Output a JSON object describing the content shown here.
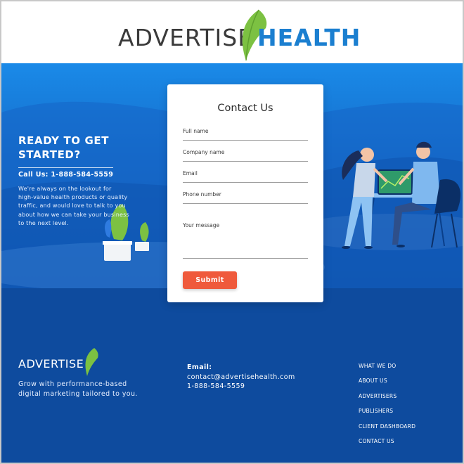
{
  "header": {
    "logo_part1": "ADVERTISE",
    "logo_part2": "HEALTH",
    "brand_color": "#1b7fd0",
    "leaf_color": "#7cc142"
  },
  "hero": {
    "title": "READY TO GET STARTED?",
    "phone": "Call Us: 1-888-584-5559",
    "text_lines": [
      "We're always on the lookout for",
      "high-value health products or quality",
      "traffic, and would love to talk to you",
      "about how we can take your business",
      "to the next level."
    ]
  },
  "form": {
    "title": "Contact Us",
    "fields": [
      {
        "label": "Full name"
      },
      {
        "label": "Company name"
      },
      {
        "label": "Email"
      },
      {
        "label": "Phone number"
      },
      {
        "label": "Your message"
      }
    ],
    "submit_label": "Submit",
    "submit_color": "#ef5a3c"
  },
  "footer": {
    "logo": "ADVERTISE",
    "tagline_line1": "Grow with performance-based",
    "tagline_line2": "digital marketing tailored to you.",
    "email_label": "Email:",
    "email": "contact@advertisehealth.com",
    "phone": "1-888-584-5559",
    "nav": [
      "WHAT WE DO",
      "ABOUT US",
      "ADVERTISERS",
      "PUBLISHERS",
      "CLIENT DASHBOARD",
      "CONTACT US"
    ],
    "background": "#0e4b9e"
  }
}
